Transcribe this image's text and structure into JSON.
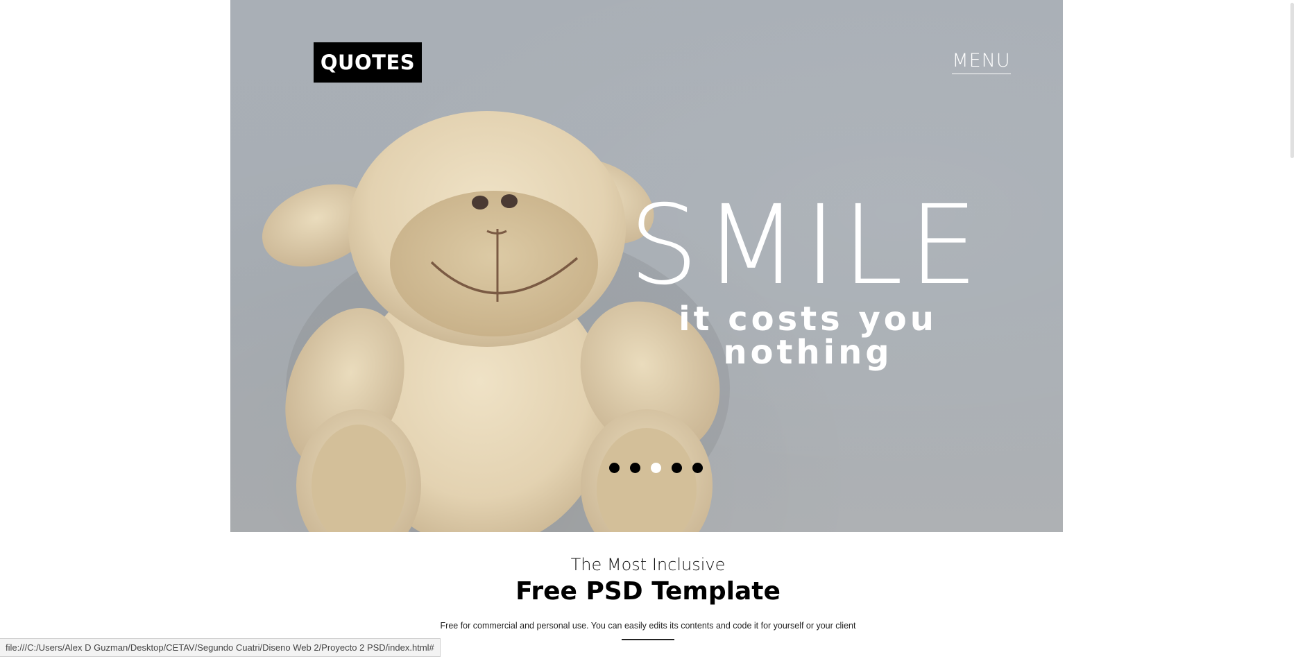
{
  "hero": {
    "logo": "QUOTES",
    "menu_label": "MENU",
    "headline": "SMILE",
    "subline": "it costs you nothing",
    "slider": {
      "dot_count": 5,
      "active_index": 2
    },
    "image_subject": "plush-lamb"
  },
  "intro": {
    "kicker": "The Most Inclusive",
    "title": "Free PSD Template",
    "description": "Free for commercial and personal use. You can easily edits its contents and code it for yourself or your client"
  },
  "status_bar": {
    "url": "file:///C:/Users/Alex D Guzman/Desktop/CETAV/Segundo Cuatri/Diseno Web 2/Proyecto 2 PSD/index.html#"
  },
  "colors": {
    "hero_bg": "#a9afb6",
    "logo_bg": "#000000",
    "text_light": "#ffffff",
    "dot_inactive": "#000000",
    "dot_active": "#ffffff"
  }
}
